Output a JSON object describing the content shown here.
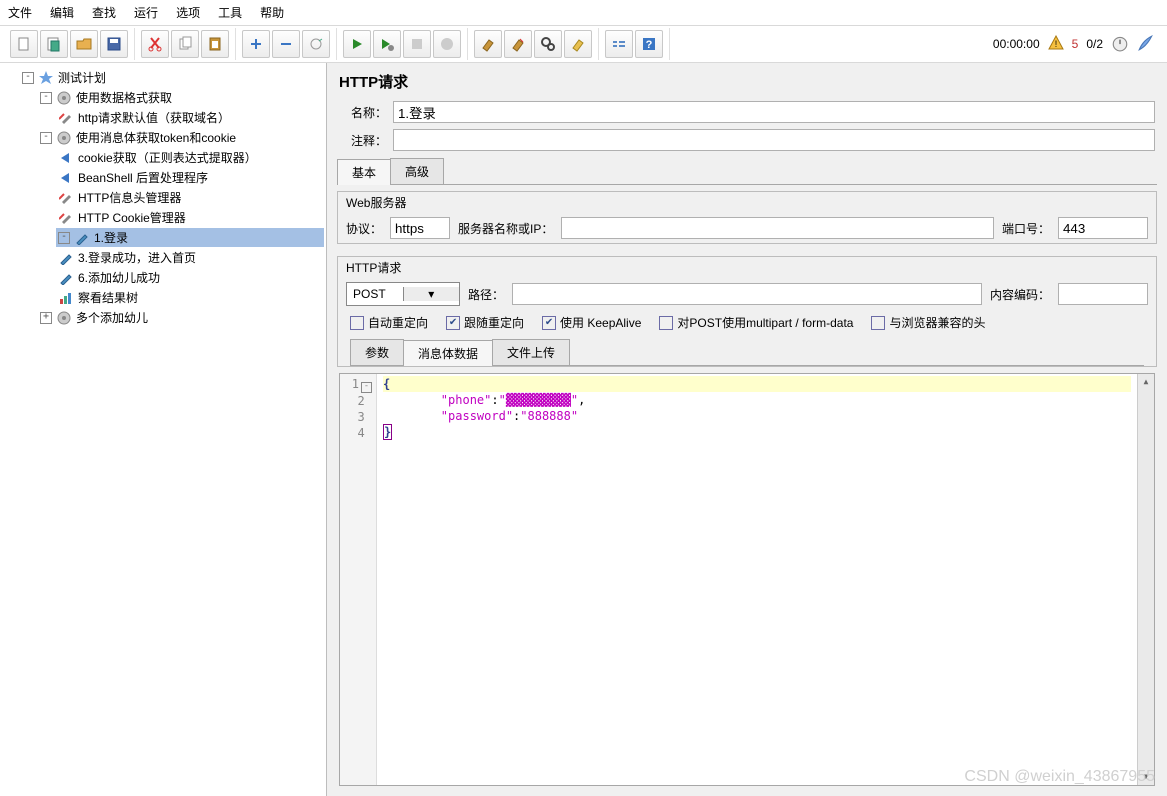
{
  "menus": [
    "文件",
    "编辑",
    "查找",
    "运行",
    "选项",
    "工具",
    "帮助"
  ],
  "status": {
    "time": "00:00:00",
    "warn": "5",
    "threads": "0/2"
  },
  "tree": {
    "root": {
      "label": "测试计划",
      "children": [
        {
          "label": "使用数据格式获取",
          "icon": "gear",
          "children": [
            {
              "label": "http请求默认值（获取域名）",
              "icon": "wrench"
            }
          ]
        },
        {
          "label": "使用消息体获取token和cookie",
          "icon": "gear",
          "children": [
            {
              "label": "cookie获取（正则表达式提取器）",
              "icon": "arrow"
            },
            {
              "label": "BeanShell 后置处理程序",
              "icon": "arrow"
            },
            {
              "label": "HTTP信息头管理器",
              "icon": "wrench"
            },
            {
              "label": "HTTP Cookie管理器",
              "icon": "wrench"
            },
            {
              "label": "1.登录",
              "icon": "pipette",
              "selected": true
            },
            {
              "label": "3.登录成功，进入首页",
              "icon": "pipette"
            },
            {
              "label": "6.添加幼儿成功",
              "icon": "pipette"
            },
            {
              "label": "察看结果树",
              "icon": "chart"
            }
          ]
        },
        {
          "label": "多个添加幼儿",
          "icon": "gear"
        }
      ]
    }
  },
  "panel": {
    "title": "HTTP请求",
    "nameLabel": "名称：",
    "nameValue": "1.登录",
    "commentLabel": "注释：",
    "commentValue": "",
    "tabs": {
      "basic": "基本",
      "advanced": "高级"
    },
    "webServer": {
      "title": "Web服务器",
      "protocolLabel": "协议：",
      "protocolValue": "https",
      "serverLabel": "服务器名称或IP：",
      "serverValue": "",
      "portLabel": "端口号：",
      "portValue": "443"
    },
    "httpReq": {
      "title": "HTTP请求",
      "method": "POST",
      "pathLabel": "路径：",
      "pathValue": "",
      "encodingLabel": "内容编码：",
      "encodingValue": ""
    },
    "checks": {
      "autoRedirect": "自动重定向",
      "followRedirect": "跟随重定向",
      "keepAlive": "使用 KeepAlive",
      "multipart": "对POST使用multipart / form-data",
      "browserHeaders": "与浏览器兼容的头"
    },
    "bodyTabs": {
      "params": "参数",
      "bodyData": "消息体数据",
      "files": "文件上传"
    },
    "body": {
      "lines": [
        "{",
        "        \"phone\":\"▓▓▓▓▓▓▓▓▓\",",
        "        \"password\":\"888888\"",
        "}"
      ]
    }
  },
  "watermark": "CSDN @weixin_43867955"
}
